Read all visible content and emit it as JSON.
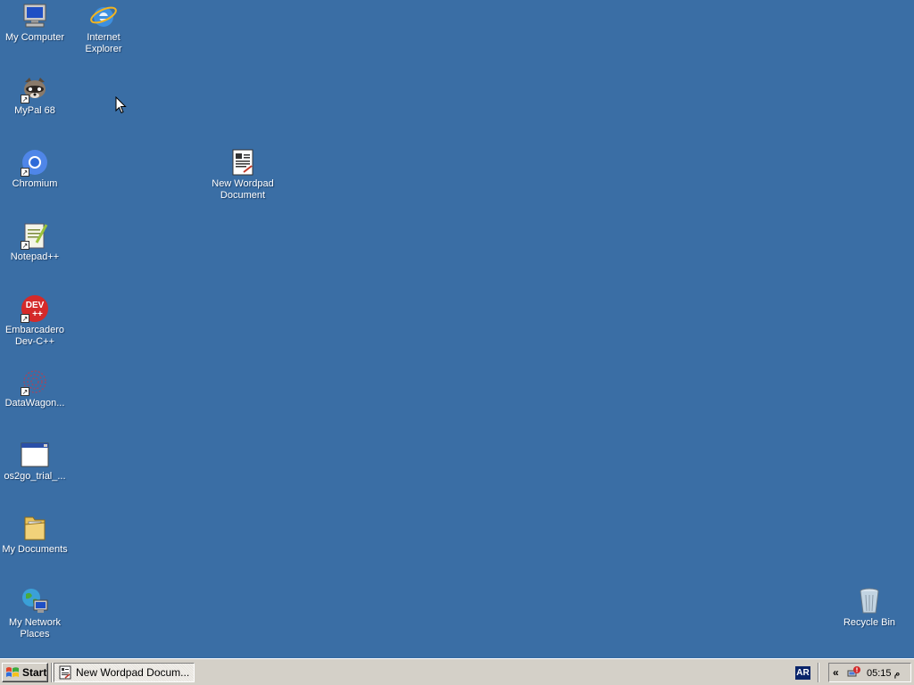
{
  "desktop": {
    "background_color": "#3a6ea5",
    "icons": {
      "my_computer": {
        "label": "My Computer",
        "icon": "computer-icon"
      },
      "internet_explorer": {
        "label": "Internet Explorer",
        "icon": "internet-explorer-icon"
      },
      "mypal": {
        "label": "MyPal 68",
        "icon": "raccoon-icon"
      },
      "chromium": {
        "label": "Chromium",
        "icon": "chromium-icon"
      },
      "new_wordpad": {
        "label": "New Wordpad Document",
        "icon": "wordpad-document-icon"
      },
      "notepadpp": {
        "label": "Notepad++",
        "icon": "notepad-plus-plus-icon"
      },
      "devcpp": {
        "label": "Embarcadero Dev-C++",
        "icon": "dev-cpp-icon",
        "badge_line1": "DEV",
        "badge_line2": "++"
      },
      "datawagon": {
        "label": "DataWagon...",
        "icon": "datawagon-icon"
      },
      "os2go": {
        "label": "os2go_trial_...",
        "icon": "window-icon"
      },
      "my_documents": {
        "label": "My Documents",
        "icon": "folder-icon"
      },
      "my_network": {
        "label": "My Network Places",
        "icon": "network-globe-icon"
      },
      "recycle_bin": {
        "label": "Recycle Bin",
        "icon": "recycle-bin-icon"
      }
    }
  },
  "taskbar": {
    "start_label": "Start",
    "tasks": [
      {
        "label": "New Wordpad Docum...",
        "icon": "wordpad-icon",
        "active": true
      }
    ],
    "language": "AR",
    "tray_expand": "«",
    "clock": "05:15 م"
  }
}
